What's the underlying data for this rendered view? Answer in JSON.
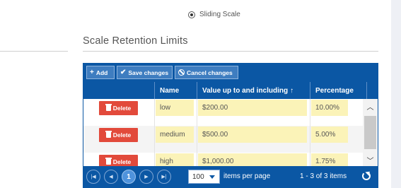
{
  "radio": {
    "label": "Sliding Scale",
    "checked": true
  },
  "section": {
    "title": "Scale Retention Limits"
  },
  "toolbar": {
    "add_label": "Add",
    "save_label": "Save changes",
    "cancel_label": "Cancel changes"
  },
  "columns": {
    "name": "Name",
    "value": "Value up to and including",
    "percentage": "Percentage"
  },
  "rows": [
    {
      "delete_label": "Delete",
      "name": "low",
      "value": "$200.00",
      "percentage": "10.00%"
    },
    {
      "delete_label": "Delete",
      "name": "medium",
      "value": "$500.00",
      "percentage": "5.00%"
    },
    {
      "delete_label": "Delete",
      "name": "high",
      "value": "$1,000.00",
      "percentage": "1.75%"
    }
  ],
  "pager": {
    "current_page": "1",
    "page_size": "100",
    "items_per_page_label": "items per page",
    "summary": "1 - 3 of 3 items"
  },
  "colors": {
    "header_blue": "#0b57a4",
    "delete_red": "#e24a3b",
    "edited_cell": "#fbf3b8"
  },
  "icons": {
    "add": "plus-icon",
    "save": "check-icon",
    "cancel": "ban-icon",
    "delete": "trash-icon",
    "sort": "arrow-up-icon",
    "refresh": "refresh-icon"
  }
}
